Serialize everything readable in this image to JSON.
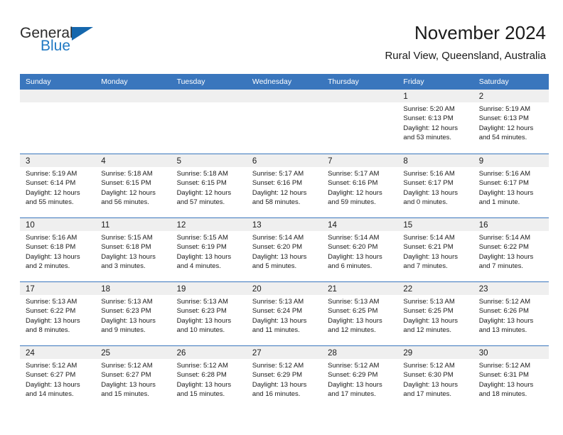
{
  "brand": {
    "name_part1": "General",
    "name_part2": "Blue"
  },
  "header": {
    "title": "November 2024",
    "subtitle": "Rural View, Queensland, Australia"
  },
  "colors": {
    "header_blue": "#3a76bd",
    "day_band_gray": "#efefef",
    "logo_blue": "#2079c3",
    "text": "#1a1a1a"
  },
  "weekdays": [
    "Sunday",
    "Monday",
    "Tuesday",
    "Wednesday",
    "Thursday",
    "Friday",
    "Saturday"
  ],
  "weeks": [
    [
      {
        "day": "",
        "sunrise": "",
        "sunset": "",
        "daylight_line1": "",
        "daylight_line2": ""
      },
      {
        "day": "",
        "sunrise": "",
        "sunset": "",
        "daylight_line1": "",
        "daylight_line2": ""
      },
      {
        "day": "",
        "sunrise": "",
        "sunset": "",
        "daylight_line1": "",
        "daylight_line2": ""
      },
      {
        "day": "",
        "sunrise": "",
        "sunset": "",
        "daylight_line1": "",
        "daylight_line2": ""
      },
      {
        "day": "",
        "sunrise": "",
        "sunset": "",
        "daylight_line1": "",
        "daylight_line2": ""
      },
      {
        "day": "1",
        "sunrise": "Sunrise: 5:20 AM",
        "sunset": "Sunset: 6:13 PM",
        "daylight_line1": "Daylight: 12 hours",
        "daylight_line2": "and 53 minutes."
      },
      {
        "day": "2",
        "sunrise": "Sunrise: 5:19 AM",
        "sunset": "Sunset: 6:13 PM",
        "daylight_line1": "Daylight: 12 hours",
        "daylight_line2": "and 54 minutes."
      }
    ],
    [
      {
        "day": "3",
        "sunrise": "Sunrise: 5:19 AM",
        "sunset": "Sunset: 6:14 PM",
        "daylight_line1": "Daylight: 12 hours",
        "daylight_line2": "and 55 minutes."
      },
      {
        "day": "4",
        "sunrise": "Sunrise: 5:18 AM",
        "sunset": "Sunset: 6:15 PM",
        "daylight_line1": "Daylight: 12 hours",
        "daylight_line2": "and 56 minutes."
      },
      {
        "day": "5",
        "sunrise": "Sunrise: 5:18 AM",
        "sunset": "Sunset: 6:15 PM",
        "daylight_line1": "Daylight: 12 hours",
        "daylight_line2": "and 57 minutes."
      },
      {
        "day": "6",
        "sunrise": "Sunrise: 5:17 AM",
        "sunset": "Sunset: 6:16 PM",
        "daylight_line1": "Daylight: 12 hours",
        "daylight_line2": "and 58 minutes."
      },
      {
        "day": "7",
        "sunrise": "Sunrise: 5:17 AM",
        "sunset": "Sunset: 6:16 PM",
        "daylight_line1": "Daylight: 12 hours",
        "daylight_line2": "and 59 minutes."
      },
      {
        "day": "8",
        "sunrise": "Sunrise: 5:16 AM",
        "sunset": "Sunset: 6:17 PM",
        "daylight_line1": "Daylight: 13 hours",
        "daylight_line2": "and 0 minutes."
      },
      {
        "day": "9",
        "sunrise": "Sunrise: 5:16 AM",
        "sunset": "Sunset: 6:17 PM",
        "daylight_line1": "Daylight: 13 hours",
        "daylight_line2": "and 1 minute."
      }
    ],
    [
      {
        "day": "10",
        "sunrise": "Sunrise: 5:16 AM",
        "sunset": "Sunset: 6:18 PM",
        "daylight_line1": "Daylight: 13 hours",
        "daylight_line2": "and 2 minutes."
      },
      {
        "day": "11",
        "sunrise": "Sunrise: 5:15 AM",
        "sunset": "Sunset: 6:18 PM",
        "daylight_line1": "Daylight: 13 hours",
        "daylight_line2": "and 3 minutes."
      },
      {
        "day": "12",
        "sunrise": "Sunrise: 5:15 AM",
        "sunset": "Sunset: 6:19 PM",
        "daylight_line1": "Daylight: 13 hours",
        "daylight_line2": "and 4 minutes."
      },
      {
        "day": "13",
        "sunrise": "Sunrise: 5:14 AM",
        "sunset": "Sunset: 6:20 PM",
        "daylight_line1": "Daylight: 13 hours",
        "daylight_line2": "and 5 minutes."
      },
      {
        "day": "14",
        "sunrise": "Sunrise: 5:14 AM",
        "sunset": "Sunset: 6:20 PM",
        "daylight_line1": "Daylight: 13 hours",
        "daylight_line2": "and 6 minutes."
      },
      {
        "day": "15",
        "sunrise": "Sunrise: 5:14 AM",
        "sunset": "Sunset: 6:21 PM",
        "daylight_line1": "Daylight: 13 hours",
        "daylight_line2": "and 7 minutes."
      },
      {
        "day": "16",
        "sunrise": "Sunrise: 5:14 AM",
        "sunset": "Sunset: 6:22 PM",
        "daylight_line1": "Daylight: 13 hours",
        "daylight_line2": "and 7 minutes."
      }
    ],
    [
      {
        "day": "17",
        "sunrise": "Sunrise: 5:13 AM",
        "sunset": "Sunset: 6:22 PM",
        "daylight_line1": "Daylight: 13 hours",
        "daylight_line2": "and 8 minutes."
      },
      {
        "day": "18",
        "sunrise": "Sunrise: 5:13 AM",
        "sunset": "Sunset: 6:23 PM",
        "daylight_line1": "Daylight: 13 hours",
        "daylight_line2": "and 9 minutes."
      },
      {
        "day": "19",
        "sunrise": "Sunrise: 5:13 AM",
        "sunset": "Sunset: 6:23 PM",
        "daylight_line1": "Daylight: 13 hours",
        "daylight_line2": "and 10 minutes."
      },
      {
        "day": "20",
        "sunrise": "Sunrise: 5:13 AM",
        "sunset": "Sunset: 6:24 PM",
        "daylight_line1": "Daylight: 13 hours",
        "daylight_line2": "and 11 minutes."
      },
      {
        "day": "21",
        "sunrise": "Sunrise: 5:13 AM",
        "sunset": "Sunset: 6:25 PM",
        "daylight_line1": "Daylight: 13 hours",
        "daylight_line2": "and 12 minutes."
      },
      {
        "day": "22",
        "sunrise": "Sunrise: 5:13 AM",
        "sunset": "Sunset: 6:25 PM",
        "daylight_line1": "Daylight: 13 hours",
        "daylight_line2": "and 12 minutes."
      },
      {
        "day": "23",
        "sunrise": "Sunrise: 5:12 AM",
        "sunset": "Sunset: 6:26 PM",
        "daylight_line1": "Daylight: 13 hours",
        "daylight_line2": "and 13 minutes."
      }
    ],
    [
      {
        "day": "24",
        "sunrise": "Sunrise: 5:12 AM",
        "sunset": "Sunset: 6:27 PM",
        "daylight_line1": "Daylight: 13 hours",
        "daylight_line2": "and 14 minutes."
      },
      {
        "day": "25",
        "sunrise": "Sunrise: 5:12 AM",
        "sunset": "Sunset: 6:27 PM",
        "daylight_line1": "Daylight: 13 hours",
        "daylight_line2": "and 15 minutes."
      },
      {
        "day": "26",
        "sunrise": "Sunrise: 5:12 AM",
        "sunset": "Sunset: 6:28 PM",
        "daylight_line1": "Daylight: 13 hours",
        "daylight_line2": "and 15 minutes."
      },
      {
        "day": "27",
        "sunrise": "Sunrise: 5:12 AM",
        "sunset": "Sunset: 6:29 PM",
        "daylight_line1": "Daylight: 13 hours",
        "daylight_line2": "and 16 minutes."
      },
      {
        "day": "28",
        "sunrise": "Sunrise: 5:12 AM",
        "sunset": "Sunset: 6:29 PM",
        "daylight_line1": "Daylight: 13 hours",
        "daylight_line2": "and 17 minutes."
      },
      {
        "day": "29",
        "sunrise": "Sunrise: 5:12 AM",
        "sunset": "Sunset: 6:30 PM",
        "daylight_line1": "Daylight: 13 hours",
        "daylight_line2": "and 17 minutes."
      },
      {
        "day": "30",
        "sunrise": "Sunrise: 5:12 AM",
        "sunset": "Sunset: 6:31 PM",
        "daylight_line1": "Daylight: 13 hours",
        "daylight_line2": "and 18 minutes."
      }
    ]
  ]
}
